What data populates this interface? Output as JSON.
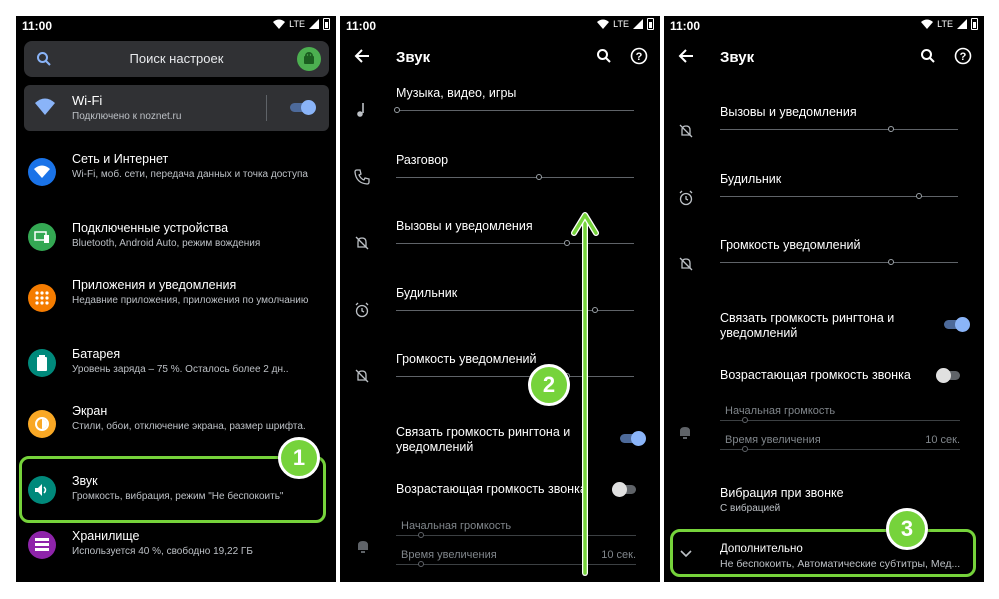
{
  "status": {
    "time": "11:00",
    "network": "LTE"
  },
  "panel1": {
    "search_text": "Поиск настроек",
    "wifi": {
      "title": "Wi-Fi",
      "subtitle": "Подключено к noznet.ru",
      "toggle": "on"
    },
    "items": [
      {
        "title": "Сеть и Интернет",
        "subtitle": "Wi-Fi, моб. сети, передача данных и точка доступа",
        "icon": "wifi-icon",
        "color": "#1a73e8"
      },
      {
        "title": "Подключенные устройства",
        "subtitle": "Bluetooth, Android Auto, режим вождения",
        "icon": "devices-icon",
        "color": "#34a853"
      },
      {
        "title": "Приложения и уведомления",
        "subtitle": "Недавние приложения, приложения по умолчанию",
        "icon": "apps-icon",
        "color": "#f57c00"
      },
      {
        "title": "Батарея",
        "subtitle": "Уровень заряда – 75 %. Осталось более 2 дн..",
        "icon": "battery-icon",
        "color": "#00897b"
      },
      {
        "title": "Экран",
        "subtitle": "Стили, обои, отключение экрана, размер шрифта.",
        "icon": "display-icon",
        "color": "#f9a825"
      },
      {
        "title": "Звук",
        "subtitle": "Громкость, вибрация, режим \"Не беспокоить\"",
        "icon": "sound-icon",
        "color": "#00897b"
      },
      {
        "title": "Хранилище",
        "subtitle": "Используется 40 %, свободно 19,22 ГБ",
        "icon": "storage-icon",
        "color": "#8e24aa"
      }
    ],
    "badge": "1"
  },
  "panel2": {
    "title": "Звук",
    "volumes": [
      {
        "label": "Музыка, видео, игры",
        "icon": "music-note-icon",
        "level": 0.0
      },
      {
        "label": "Разговор",
        "icon": "phone-icon",
        "level": 0.6
      },
      {
        "label": "Вызовы и уведомления",
        "icon": "bell-off-icon",
        "level": 0.72
      },
      {
        "label": "Будильник",
        "icon": "alarm-icon",
        "level": 0.84
      },
      {
        "label": "Громкость уведомлений",
        "icon": "bell-off-icon",
        "level": 0.72
      }
    ],
    "link_ringtone": "Связать громкость рингтона и уведомлений",
    "rising_ring": "Возрастающая громкость звонка",
    "start_volume": "Начальная громкость",
    "increase_time": "Время увеличения",
    "increase_value": "10 сек.",
    "badge": "2"
  },
  "panel3": {
    "title": "Звук",
    "volumes": [
      {
        "label": "Вызовы и уведомления",
        "icon": "bell-off-icon",
        "level": 0.72
      },
      {
        "label": "Будильник",
        "icon": "alarm-icon",
        "level": 0.84
      },
      {
        "label": "Громкость уведомлений",
        "icon": "bell-off-icon",
        "level": 0.72
      }
    ],
    "link_ringtone": "Связать громкость рингтона и уведомлений",
    "rising_ring": "Возрастающая громкость звонка",
    "start_volume": "Начальная громкость",
    "increase_time": "Время увеличения",
    "increase_value": "10 сек.",
    "vibration_title": "Вибрация при звонке",
    "vibration_sub": "С вибрацией",
    "advanced_title": "Дополнительно",
    "advanced_sub": "Не беспокоить, Автоматические субтитры, Мед...",
    "badge": "3"
  }
}
